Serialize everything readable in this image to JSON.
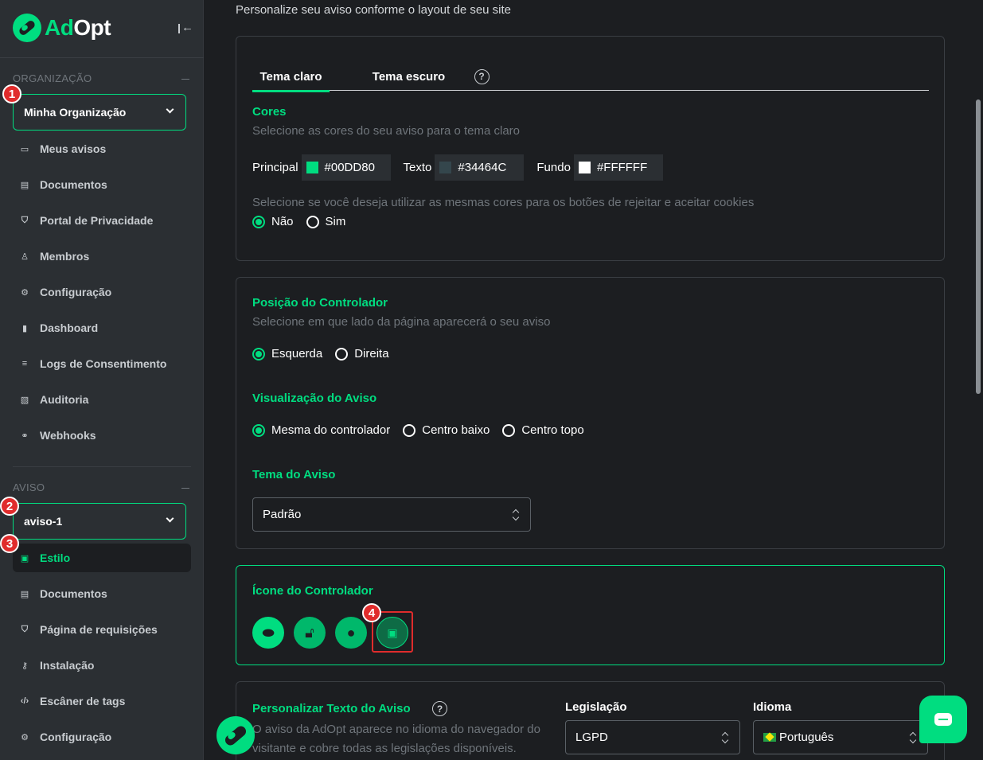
{
  "brand": {
    "part1": "Ad",
    "part2": "Opt"
  },
  "sidebar": {
    "org_section": "ORGANIZAÇÃO",
    "org_select": "Minha Organização",
    "org_items": [
      {
        "label": "Meus avisos",
        "icon": "chat-icon"
      },
      {
        "label": "Documentos",
        "icon": "document-icon"
      },
      {
        "label": "Portal de Privacidade",
        "icon": "shield-icon"
      },
      {
        "label": "Membros",
        "icon": "users-icon"
      },
      {
        "label": "Configuração",
        "icon": "gear-icon"
      },
      {
        "label": "Dashboard",
        "icon": "bar-chart-icon"
      },
      {
        "label": "Logs de Consentimento",
        "icon": "list-icon"
      },
      {
        "label": "Auditoria",
        "icon": "audit-icon"
      },
      {
        "label": "Webhooks",
        "icon": "webhook-icon"
      }
    ],
    "aviso_section": "AVISO",
    "aviso_select": "aviso-1",
    "aviso_items": [
      {
        "label": "Estilo",
        "icon": "palette-icon",
        "active": true
      },
      {
        "label": "Documentos",
        "icon": "document-icon"
      },
      {
        "label": "Página de requisições",
        "icon": "shield-icon"
      },
      {
        "label": "Instalação",
        "icon": "key-icon"
      },
      {
        "label": "Escâner de tags",
        "icon": "code-icon"
      },
      {
        "label": "Configuração",
        "icon": "gear-icon"
      }
    ]
  },
  "badges": [
    "1",
    "2",
    "3",
    "4"
  ],
  "main": {
    "intro": "Personalize seu aviso conforme o layout de seu site",
    "tabs": [
      {
        "label": "Tema claro"
      },
      {
        "label": "Tema escuro"
      }
    ],
    "help_glyph": "?",
    "cores": {
      "title": "Cores",
      "subtitle": "Selecione as cores do seu aviso para o tema claro",
      "principal_label": "Principal",
      "principal_value": "#00DD80",
      "texto_label": "Texto",
      "texto_value": "#34464C",
      "fundo_label": "Fundo",
      "fundo_value": "#FFFFFF",
      "same_colors_question": "Selecione se você deseja utilizar as mesmas cores para os botões de rejeitar e aceitar cookies",
      "opt_no": "Não",
      "opt_yes": "Sim"
    },
    "posicao": {
      "title": "Posição do Controlador",
      "subtitle": "Selecione em que lado da página aparecerá o seu aviso",
      "opt_left": "Esquerda",
      "opt_right": "Direita"
    },
    "visualizacao": {
      "title": "Visualização do Aviso",
      "opt_same": "Mesma do controlador",
      "opt_bottom": "Centro baixo",
      "opt_top": "Centro topo"
    },
    "tema_aviso": {
      "title": "Tema do Aviso",
      "value": "Padrão"
    },
    "icone": {
      "title": "Ícone do Controlador"
    },
    "texto_aviso": {
      "title": "Personalizar Texto do Aviso",
      "desc": "O aviso da AdOpt aparece no idioma do navegador do visitante e cobre todas as legislações disponíveis.",
      "legis_label": "Legislação",
      "legis_value": "LGPD",
      "idioma_label": "Idioma",
      "idioma_value": "Português"
    }
  },
  "colors": {
    "accent": "#00DD80",
    "background": "#1C1E21",
    "sidebar": "#2B2F33",
    "badge": "#E02C2C"
  }
}
